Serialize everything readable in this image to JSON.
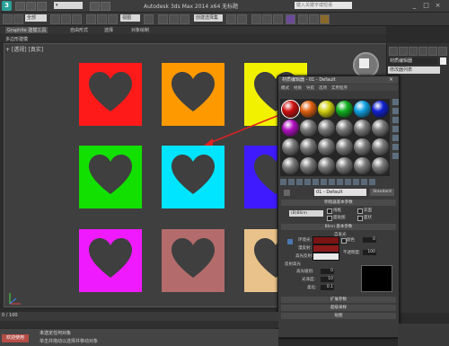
{
  "titlebar": {
    "app_letter": "3",
    "title": "Autodesk 3ds Max 2014 x64   无标题",
    "search_placeholder": "键入关键字或短语"
  },
  "toolbar": {
    "undo_dropdown": "全部",
    "view_dropdown": "视图",
    "create_selection": "创建选择集"
  },
  "ribbon": {
    "tabs": [
      "Graphite 建模工具",
      "自由形式",
      "选择",
      "对象绘制"
    ],
    "sub": "多边形建模"
  },
  "viewport": {
    "label": "+ [透视] [真实]"
  },
  "tiles": [
    {
      "row": 1,
      "col": 1,
      "color": "#ff1a1a"
    },
    {
      "row": 1,
      "col": 2,
      "color": "#ff9900"
    },
    {
      "row": 1,
      "col": 3,
      "color": "#f2f200"
    },
    {
      "row": 2,
      "col": 1,
      "color": "#12e000"
    },
    {
      "row": 2,
      "col": 2,
      "color": "#00e5ff"
    },
    {
      "row": 2,
      "col": 3,
      "color": "#3f1aff"
    },
    {
      "row": 3,
      "col": 1,
      "color": "#f01aff"
    },
    {
      "row": 3,
      "col": 2,
      "color": "#b36b6b"
    },
    {
      "row": 3,
      "col": 3,
      "color": "#e8c28a"
    }
  ],
  "command_panel": {
    "object_name": "材质编辑器",
    "modifier_list": "修改器列表"
  },
  "material_editor": {
    "title": "材质编辑器 - 01 - Default",
    "menus": [
      "模式",
      "材质",
      "导航",
      "选项",
      "实用程序"
    ],
    "slot_colors": [
      "#d01010",
      "#e06010",
      "#d0d010",
      "#10b020",
      "#10a0e0",
      "#1020d0",
      "#b010c0"
    ],
    "material_name": "01 - Default",
    "material_type": "Standard",
    "rollouts": {
      "shader_basic": "明暗器基本参数",
      "blinn_basic": "Blinn 基本参数",
      "extended": "扩展参数",
      "supersampling": "超级采样",
      "maps": "贴图"
    },
    "shader_type": "(B)Blinn",
    "checkboxes": [
      "线框",
      "双面",
      "面贴图",
      "面状"
    ],
    "labels": {
      "ambient": "环境光:",
      "diffuse": "漫反射:",
      "specular": "高光反射:",
      "self_illum": "自发光",
      "color": "颜色",
      "opacity": "不透明度:",
      "spec_highlights": "反射高光",
      "spec_level": "高光级别:",
      "glossiness": "光泽度:",
      "soften": "柔化:"
    },
    "values": {
      "color": "0",
      "opacity": "100",
      "spec_level": "0",
      "glossiness": "10",
      "soften": "0.1"
    },
    "swatches": {
      "ambient": "#7a1414",
      "diffuse": "#8c1a1a",
      "specular": "#e8e8e8"
    }
  },
  "timeline": {
    "frame": "0 / 100"
  },
  "status": {
    "line1": "未选定任何对象",
    "line2": "单击并拖动以选择并移动对象",
    "script": "欢迎使用"
  }
}
